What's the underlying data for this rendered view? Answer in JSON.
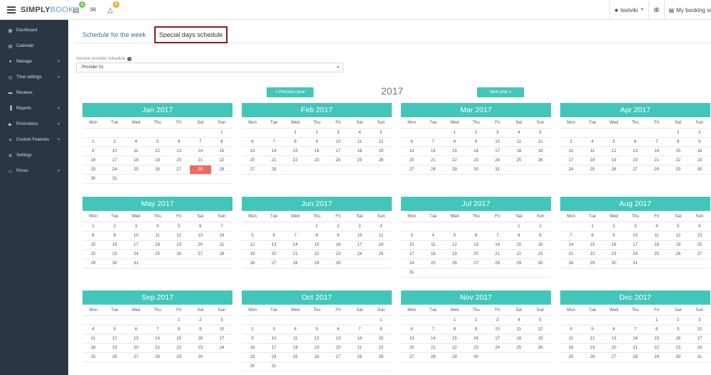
{
  "brand": {
    "left": "SIMPLY",
    "right": "BOOK"
  },
  "topbar": {
    "badges": {
      "bookings": "3",
      "notifications": "9"
    },
    "user": "testviki",
    "site_link": "My booking si"
  },
  "sidebar": {
    "items": [
      {
        "label": "Dashboard",
        "icon": "dashboard-icon",
        "glyph": "▦",
        "chevron": false
      },
      {
        "label": "Calendar",
        "icon": "calendar-icon",
        "glyph": "▤",
        "chevron": false
      },
      {
        "label": "Manage",
        "icon": "user-icon",
        "glyph": "●",
        "chevron": true
      },
      {
        "label": "Time settings",
        "icon": "clock-icon",
        "glyph": "◷",
        "chevron": true
      },
      {
        "label": "Reviews",
        "icon": "comments-icon",
        "glyph": "▬",
        "chevron": false
      },
      {
        "label": "Reports",
        "icon": "bar-chart-icon",
        "glyph": "▐",
        "chevron": true
      },
      {
        "label": "Promotions",
        "icon": "bullhorn-icon",
        "glyph": "▶",
        "chevron": true
      },
      {
        "label": "Custom Features",
        "icon": "rocket-icon",
        "glyph": "✈",
        "chevron": true
      },
      {
        "label": "Settings",
        "icon": "cogs-icon",
        "glyph": "⚙",
        "chevron": false
      },
      {
        "label": "Prices",
        "icon": "credit-card-icon",
        "glyph": "▭",
        "chevron": true
      }
    ]
  },
  "tabs": {
    "week": "Schedule for the week",
    "special": "Special days schedule"
  },
  "provider": {
    "label": "Service provider schedule",
    "value": "Provider 01"
  },
  "year_nav": {
    "prev": "« Previous year",
    "year": "2017",
    "next": "Next year »"
  },
  "weekday_labels": [
    "Mon",
    "Tue",
    "Wed",
    "Thu",
    "Fri",
    "Sat",
    "Sun"
  ],
  "colors": {
    "accent": "#43c6ba",
    "special_day": "#f06b5e",
    "sidebar": "#2c3643"
  },
  "months": [
    {
      "title": "Jan 2017",
      "offset": 6,
      "days": 31,
      "special": [
        28
      ]
    },
    {
      "title": "Feb 2017",
      "offset": 2,
      "days": 28,
      "special": []
    },
    {
      "title": "Mar 2017",
      "offset": 2,
      "days": 31,
      "special": []
    },
    {
      "title": "Apr 2017",
      "offset": 5,
      "days": 30,
      "special": []
    },
    {
      "title": "May 2017",
      "offset": 0,
      "days": 31,
      "special": []
    },
    {
      "title": "Jun 2017",
      "offset": 3,
      "days": 30,
      "special": []
    },
    {
      "title": "Jul 2017",
      "offset": 5,
      "days": 31,
      "special": []
    },
    {
      "title": "Aug 2017",
      "offset": 1,
      "days": 31,
      "special": []
    },
    {
      "title": "Sep 2017",
      "offset": 4,
      "days": 30,
      "special": []
    },
    {
      "title": "Oct 2017",
      "offset": 6,
      "days": 31,
      "special": []
    },
    {
      "title": "Nov 2017",
      "offset": 2,
      "days": 30,
      "special": []
    },
    {
      "title": "Dec 2017",
      "offset": 4,
      "days": 31,
      "special": []
    }
  ]
}
